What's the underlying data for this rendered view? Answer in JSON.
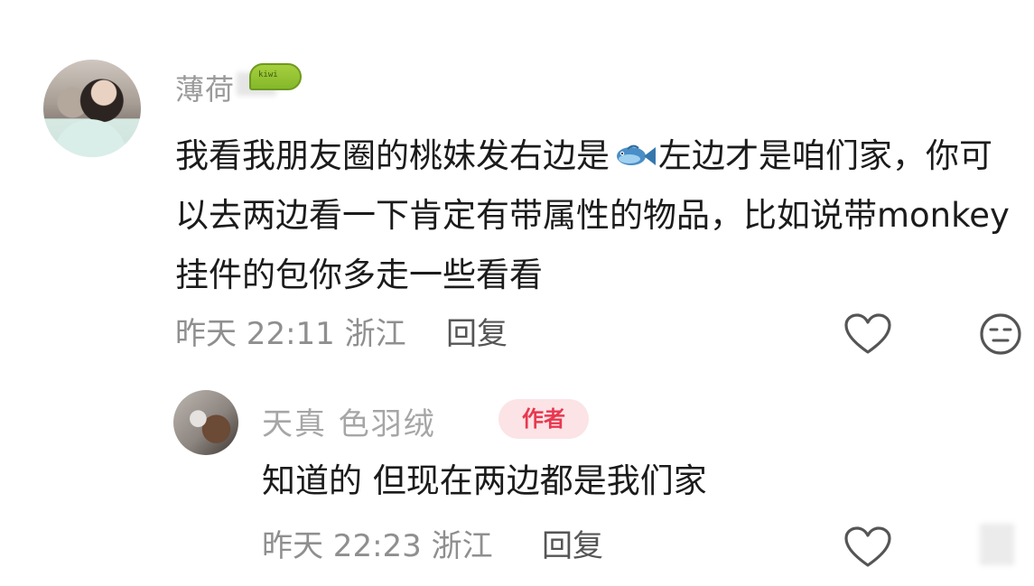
{
  "main_comment": {
    "username": "薄荷",
    "badge_text": "kiwi",
    "text_part1": "我看我朋友圈的桃妹发右边是",
    "text_part2": "左边才是咱们家，你可以去两边看一下肯定有带属性的物品，比如说带monkey挂件的包你多走一些看看",
    "timestamp": "昨天 22:11 浙江",
    "reply_label": "回复",
    "icons": [
      "avatar",
      "kiwi-badge-icon",
      "fish-icon",
      "heart-icon",
      "dislike-face-icon"
    ]
  },
  "reply_comment": {
    "username": "天真        色羽绒",
    "author_badge": "作者",
    "text": "知道的 但现在两边都是我们家",
    "timestamp": "昨天 22:23 浙江",
    "reply_label": "回复",
    "icons": [
      "avatar",
      "heart-icon"
    ]
  },
  "colors": {
    "primary_text": "#1b1b1b",
    "secondary_text": "#8f8f8f",
    "author_badge_bg": "#fbe3e6",
    "author_badge_text": "#e8384f"
  }
}
